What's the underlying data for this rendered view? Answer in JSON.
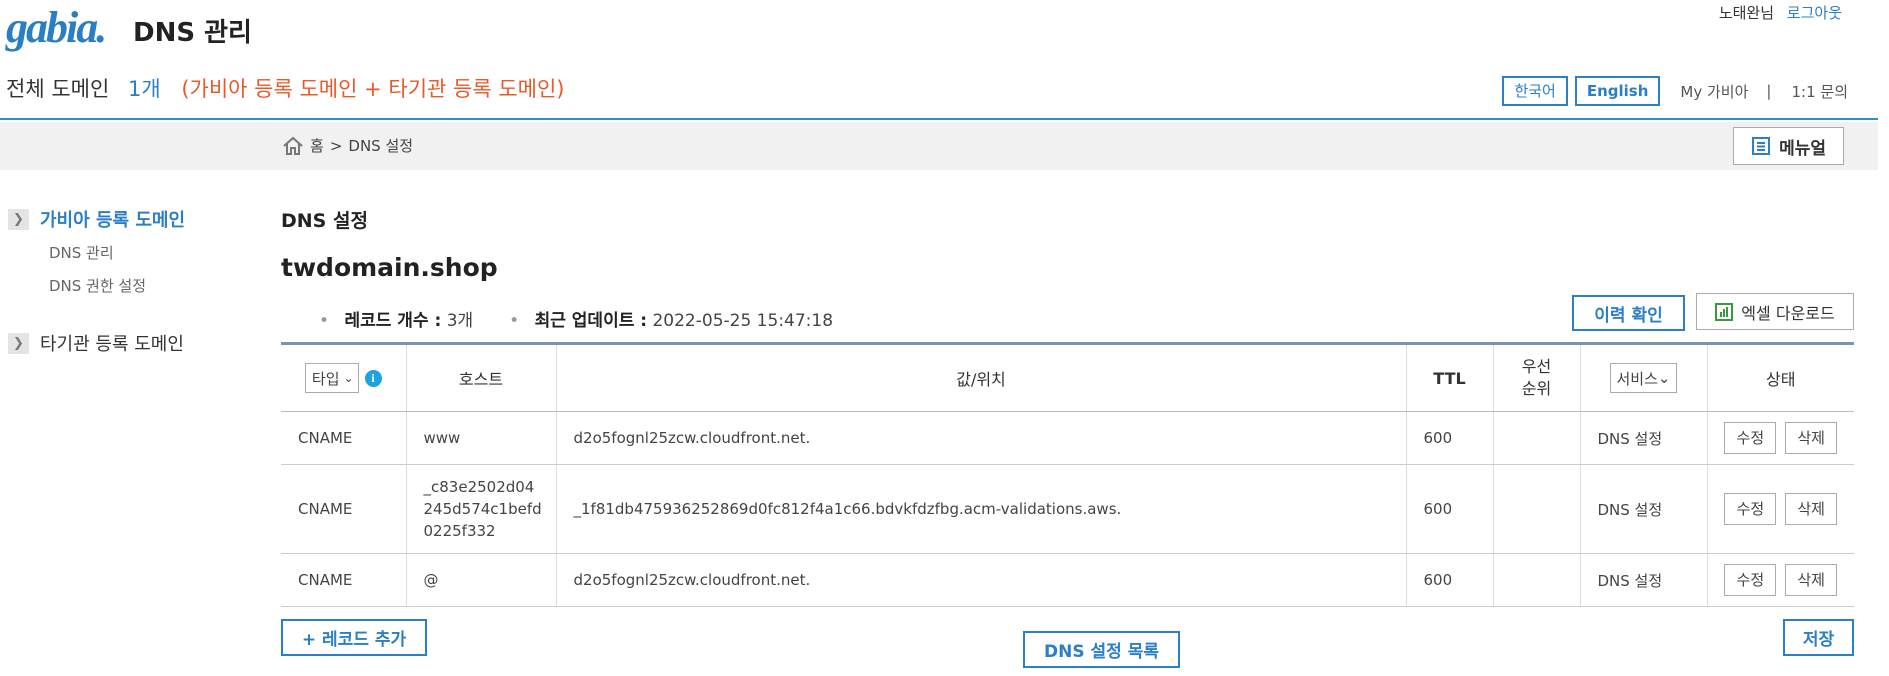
{
  "header": {
    "logo": "gabia.",
    "title": "DNS 관리",
    "user_name": "노태완님",
    "logout": "로그아웃",
    "domain_label": "전체 도메인",
    "domain_count": "1개",
    "domain_note": "(가비아 등록 도메인 + 타기관 등록 도메인)",
    "lang_ko": "한국어",
    "lang_en": "English",
    "my_gabia": "My 가비아",
    "separator": "|",
    "inquiry": "1:1 문의"
  },
  "breadcrumb": {
    "home": "홈",
    "sep": ">",
    "current": "DNS 설정",
    "manual": "메뉴얼"
  },
  "sidebar": {
    "groups": [
      {
        "title": "가비아 등록 도메인",
        "items": [
          "DNS 관리",
          "DNS 권한 설정"
        ]
      },
      {
        "title": "타기관 등록 도메인",
        "items": []
      }
    ]
  },
  "main": {
    "section_title": "DNS 설정",
    "domain": "twdomain.shop",
    "record_count_label": "레코드 개수 :",
    "record_count": "3개",
    "updated_label": "최근 업데이트 :",
    "updated_value": "2022-05-25 15:47:18",
    "history_button": "이력 확인",
    "excel_button": "엑셀 다운로드",
    "columns": {
      "type": "타입",
      "host": "호스트",
      "value": "값/위치",
      "ttl": "TTL",
      "priority": "우선\n순위",
      "service": "서비스",
      "status": "상태"
    },
    "rows": [
      {
        "type": "CNAME",
        "host": "www",
        "value": "d2o5fognl25zcw.cloudfront.net.",
        "ttl": "600",
        "priority": "",
        "service": "DNS 설정",
        "edit": "수정",
        "delete": "삭제"
      },
      {
        "type": "CNAME",
        "host": "_c83e2502d04245d574c1befd0225f332",
        "value": "_1f81db475936252869d0fc812f4a1c66.bdvkfdzfbg.acm-validations.aws.",
        "ttl": "600",
        "priority": "",
        "service": "DNS 설정",
        "edit": "수정",
        "delete": "삭제"
      },
      {
        "type": "CNAME",
        "host": "@",
        "value": "d2o5fognl25zcw.cloudfront.net.",
        "ttl": "600",
        "priority": "",
        "service": "DNS 설정",
        "edit": "수정",
        "delete": "삭제"
      }
    ],
    "add_record": "+ 레코드 추가",
    "dns_list": "DNS 설정 목록",
    "save": "저장"
  },
  "colors": {
    "accent": "#2b7fc9",
    "note": "#e85a2a",
    "table_border": "#7a93b4"
  }
}
